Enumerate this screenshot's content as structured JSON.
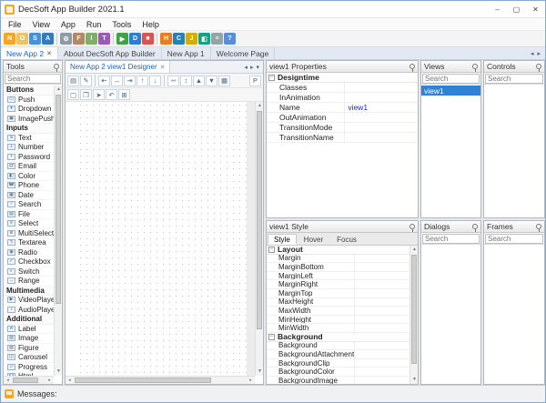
{
  "window": {
    "title": "DecSoft App Builder 2021.1",
    "controls": {
      "minimize": "–",
      "maximize": "▢",
      "close": "✕"
    }
  },
  "menubar": {
    "items": [
      "File",
      "View",
      "App",
      "Run",
      "Tools",
      "Help"
    ]
  },
  "toolbar": {
    "icons": [
      {
        "name": "new-app-icon",
        "glyph": "N",
        "bg": "#f5a623"
      },
      {
        "name": "open-app-icon",
        "glyph": "O",
        "bg": "#e9c46a"
      },
      {
        "name": "save-app-icon",
        "glyph": "S",
        "bg": "#4a90d9"
      },
      {
        "name": "save-all-icon",
        "glyph": "A",
        "bg": "#357abd"
      },
      {
        "sep": true
      },
      {
        "name": "app-options-icon",
        "glyph": "⚙",
        "bg": "#8e9aa6"
      },
      {
        "name": "app-files-icon",
        "glyph": "F",
        "bg": "#b08968"
      },
      {
        "name": "app-images-icon",
        "glyph": "I",
        "bg": "#7fb069"
      },
      {
        "name": "app-themes-icon",
        "glyph": "T",
        "bg": "#9b59b6"
      },
      {
        "sep": true
      },
      {
        "name": "run-app-icon",
        "glyph": "▶",
        "bg": "#43a047"
      },
      {
        "name": "debug-app-icon",
        "glyph": "D",
        "bg": "#2e7dd1"
      },
      {
        "name": "stop-app-icon",
        "glyph": "■",
        "bg": "#d9534f"
      },
      {
        "sep": true
      },
      {
        "name": "html-editor-icon",
        "glyph": "H",
        "bg": "#e67e22"
      },
      {
        "name": "css-editor-icon",
        "glyph": "C",
        "bg": "#2980b9"
      },
      {
        "name": "js-editor-icon",
        "glyph": "J",
        "bg": "#d4ac0d"
      },
      {
        "name": "color-picker-icon",
        "glyph": "◧",
        "bg": "#16a085"
      },
      {
        "name": "notes-icon",
        "glyph": "≡",
        "bg": "#95a5a6"
      },
      {
        "name": "help-icon",
        "glyph": "?",
        "bg": "#5b8dd9"
      }
    ]
  },
  "app_tabs": {
    "tabs": [
      {
        "label": "New App 2",
        "active": true,
        "closable": true
      },
      {
        "label": "About DecSoft App Builder",
        "active": false,
        "closable": false
      },
      {
        "label": "New App 1",
        "active": false,
        "closable": false
      },
      {
        "label": "Welcome Page",
        "active": false,
        "closable": false
      }
    ]
  },
  "tools_panel": {
    "title": "Tools",
    "search_placeholder": "Search",
    "sections": [
      {
        "title": "Buttons",
        "items": [
          {
            "label": "Push",
            "glyph": "▭"
          },
          {
            "label": "Dropdown",
            "glyph": "▾"
          },
          {
            "label": "ImagePush",
            "glyph": "▣"
          }
        ]
      },
      {
        "title": "Inputs",
        "items": [
          {
            "label": "Text",
            "glyph": "a"
          },
          {
            "label": "Number",
            "glyph": "1"
          },
          {
            "label": "Password",
            "glyph": "•"
          },
          {
            "label": "Email",
            "glyph": "@"
          },
          {
            "label": "Color",
            "glyph": "◧"
          },
          {
            "label": "Phone",
            "glyph": "☎"
          },
          {
            "label": "Date",
            "glyph": "▦"
          },
          {
            "label": "Search",
            "glyph": "○"
          },
          {
            "label": "File",
            "glyph": "▤"
          },
          {
            "label": "Select",
            "glyph": "≡"
          },
          {
            "label": "MultiSelect",
            "glyph": "≣"
          },
          {
            "label": "Textarea",
            "glyph": "¶"
          },
          {
            "label": "Radio",
            "glyph": "◉"
          },
          {
            "label": "Checkbox",
            "glyph": "✓"
          },
          {
            "label": "Switch",
            "glyph": "◐"
          },
          {
            "label": "Range",
            "glyph": "↔"
          }
        ]
      },
      {
        "title": "Multimedia",
        "items": [
          {
            "label": "VideoPlayer",
            "glyph": "▶"
          },
          {
            "label": "AudioPlayer",
            "glyph": "♪"
          }
        ]
      },
      {
        "title": "Additional",
        "items": [
          {
            "label": "Label",
            "glyph": "A"
          },
          {
            "label": "Image",
            "glyph": "▨"
          },
          {
            "label": "Figure",
            "glyph": "▧"
          },
          {
            "label": "Carousel",
            "glyph": "◫"
          },
          {
            "label": "Progress",
            "glyph": "▱"
          },
          {
            "label": "Html",
            "glyph": "<>"
          }
        ]
      }
    ]
  },
  "designer": {
    "tab": "New App 2 view1 Designer",
    "toolbar1": [
      {
        "name": "show-properties-icon",
        "glyph": "▤"
      },
      {
        "name": "edit-view-icon",
        "glyph": "✎"
      },
      {
        "sep": true
      },
      {
        "name": "align-left-icon",
        "glyph": "⇤"
      },
      {
        "name": "align-center-icon",
        "glyph": "↔"
      },
      {
        "name": "align-right-icon",
        "glyph": "⇥"
      },
      {
        "name": "align-top-icon",
        "glyph": "↑"
      },
      {
        "name": "align-bottom-icon",
        "glyph": "↓"
      },
      {
        "sep": true
      },
      {
        "name": "same-width-icon",
        "glyph": "⇿"
      },
      {
        "name": "same-height-icon",
        "glyph": "↕"
      },
      {
        "name": "bring-front-icon",
        "glyph": "▲"
      },
      {
        "name": "send-back-icon",
        "glyph": "▼"
      },
      {
        "name": "toggle-grid-icon",
        "glyph": "▦"
      }
    ],
    "printer_glyph": "P",
    "toolbar2": [
      {
        "name": "new-control-icon",
        "glyph": "▢"
      },
      {
        "name": "duplicate-control-icon",
        "glyph": "❐"
      },
      {
        "name": "select-mode-icon",
        "glyph": "➤"
      },
      {
        "name": "undo-icon",
        "glyph": "↶"
      },
      {
        "name": "grid-options-icon",
        "glyph": "⊞"
      }
    ]
  },
  "properties_panel": {
    "title": "view1 Properties",
    "section": "Designtime",
    "rows": [
      {
        "name": "Classes",
        "value": ""
      },
      {
        "name": "InAnimation",
        "value": ""
      },
      {
        "name": "Name",
        "value": "view1"
      },
      {
        "name": "OutAnimation",
        "value": ""
      },
      {
        "name": "TransitionMode",
        "value": ""
      },
      {
        "name": "TransitionName",
        "value": ""
      }
    ]
  },
  "style_panel": {
    "title": "view1 Style",
    "tabs": [
      "Style",
      "Hover",
      "Focus"
    ],
    "active_tab": "Style",
    "sections": [
      {
        "title": "Layout",
        "rows": [
          "Margin",
          "MarginBottom",
          "MarginLeft",
          "MarginRight",
          "MarginTop",
          "MaxHeight",
          "MaxWidth",
          "MinHeight",
          "MinWidth"
        ]
      },
      {
        "title": "Background",
        "rows": [
          "Background",
          "BackgroundAttachment",
          "BackgroundClip",
          "BackgroundColor",
          "BackgroundImage"
        ]
      }
    ]
  },
  "views_panel": {
    "title": "Views",
    "search_placeholder": "Search",
    "items": [
      {
        "label": "view1",
        "selected": true
      }
    ]
  },
  "controls_panel": {
    "title": "Controls",
    "search_placeholder": "Search",
    "items": []
  },
  "dialogs_panel": {
    "title": "Dialogs",
    "search_placeholder": "Search",
    "items": []
  },
  "frames_panel": {
    "title": "Frames",
    "search_placeholder": "Search",
    "items": []
  },
  "statusbar": {
    "label": "Messages:"
  },
  "misc": {
    "close_glyph": "✕",
    "collapse_glyph": "−",
    "up_arrow": "▲",
    "down_arrow": "▼",
    "left_arrow": "◂",
    "right_arrow": "▸",
    "dropdown_arrow": "▾"
  },
  "colors": {
    "accent_blue": "#1464c8",
    "selection_blue": "#2f83d6",
    "value_blue": "#1b2cc8",
    "app_orange": "#f5a623"
  }
}
